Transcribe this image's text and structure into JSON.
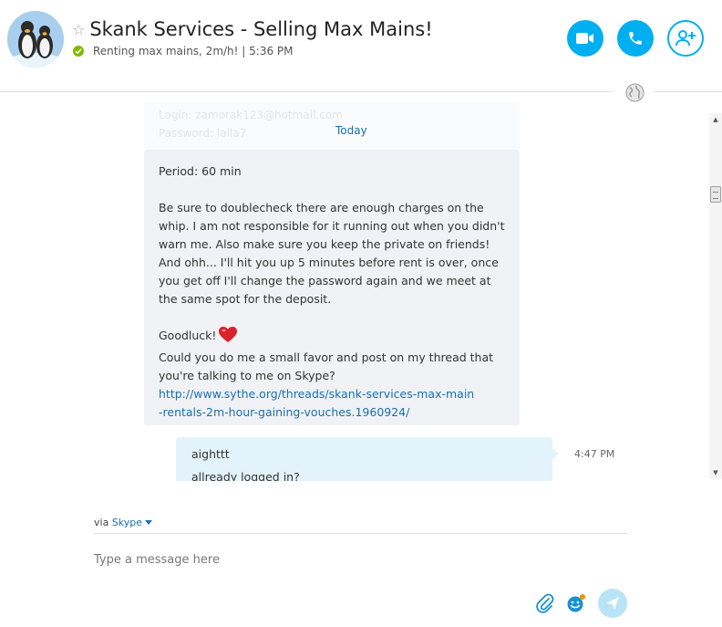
{
  "header": {
    "title": "Skank Services - Selling Max Mains!",
    "status_text": "Renting max mains, 2m/h!  |  5:36 PM",
    "buttons": {
      "video_icon": "video-camera-icon",
      "call_icon": "phone-icon",
      "add_icon": "add-person-icon"
    }
  },
  "chat": {
    "ghost_lines": [
      "Login: zamorak123@hotmail.com",
      "Password: lalla7"
    ],
    "date_divider": "Today",
    "incoming": {
      "lines": [
        "Period: 60 min",
        "",
        "Be sure to doublecheck there are enough charges on the",
        "whip. I am not responsible for it running out when you didn't",
        "warn me. Also make sure you keep the private on friends!",
        "And ohh... I'll hit you up 5 minutes before rent is over, once",
        "you get off I'll change the password again and we meet at",
        "the same spot for the deposit.",
        ""
      ],
      "goodluck": "Goodluck!",
      "favor_line1": "Could you do me a small favor and post on my thread that",
      "favor_line2": "you're talking to me on Skype?",
      "link_line1": "http://www.sythe.org/threads/skank-services-max-main",
      "link_line2": "-rentals-2m-hour-gaining-vouches.1960924/"
    },
    "outgoing": {
      "line1": "aighttt",
      "line2": "allready logged in?",
      "time": "4:47 PM"
    }
  },
  "compose": {
    "via_prefix": "via",
    "via_service": "Skype",
    "placeholder": "Type a message here"
  },
  "colors": {
    "accent": "#00aff0",
    "link": "#1b6fae",
    "incoming_bubble": "#f0f2f5",
    "outgoing_bubble": "#e3f3fb",
    "online": "#7fba00"
  }
}
